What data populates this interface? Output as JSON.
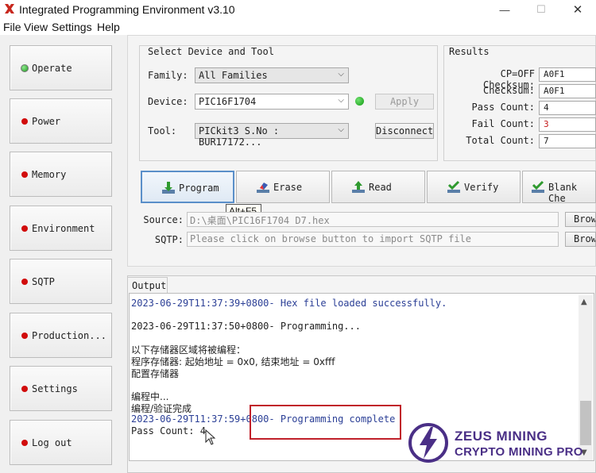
{
  "window": {
    "title": "Integrated Programming Environment v3.10",
    "minimize": "—",
    "maximize": "☐",
    "close": "✕"
  },
  "menu": [
    "File",
    "View",
    "Settings",
    "Help"
  ],
  "sidebar": {
    "items": [
      {
        "label": "Operate",
        "status": "green"
      },
      {
        "label": "Power",
        "status": "red"
      },
      {
        "label": "Memory",
        "status": "red"
      },
      {
        "label": "Environment",
        "status": "red"
      },
      {
        "label": "SQTP",
        "status": "red"
      },
      {
        "label": "Production...",
        "status": "red"
      },
      {
        "label": "Settings",
        "status": "red"
      },
      {
        "label": "Log out",
        "status": "red"
      }
    ]
  },
  "device_group": {
    "title": "Select Device and Tool",
    "family_label": "Family:",
    "family_value": "All Families",
    "device_label": "Device:",
    "device_value": "PIC16F1704",
    "apply_label": "Apply",
    "tool_label": "Tool:",
    "tool_value": "PICkit3 S.No : BUR17172...",
    "disconnect_label": "Disconnect"
  },
  "results": {
    "title": "Results",
    "rows": [
      {
        "label": "CP=OFF Checksum:",
        "value": "A0F1",
        "highlight": false
      },
      {
        "label": "Checksum:",
        "value": "A0F1",
        "highlight": false
      },
      {
        "label": "Pass Count:",
        "value": "4",
        "highlight": false
      },
      {
        "label": "Fail Count:",
        "value": "3",
        "highlight": true
      },
      {
        "label": "Total Count:",
        "value": "7",
        "highlight": false
      }
    ]
  },
  "actions": {
    "program": "Program",
    "erase": "Erase",
    "read": "Read",
    "verify": "Verify",
    "blank_check": "Blank Che",
    "tooltip": "Alt+F5"
  },
  "files": {
    "source_label": "Source:",
    "source_value": "D:\\桌面\\PIC16F1704 D7.hex",
    "sqtp_label": "SQTP:",
    "sqtp_value": "Please click on browse button to import SQTP file",
    "browse_label": "Brow"
  },
  "output": {
    "tab": "Output",
    "lines": [
      "2023-06-29T11:37:39+0800- Hex file loaded successfully.",
      "2023-06-29T11:37:50+0800- Programming...",
      "以下存储器区域将被编程：",
      "程序存储器: 起始地址 = 0x0, 结束地址 = 0xfff",
      "配置存储器",
      "编程中...",
      "编程/验证完成",
      "2023-06-29T11:37:59+0800- Programming complete",
      "Pass Count: 4"
    ]
  },
  "watermark": {
    "line1": "ZEUS MINING",
    "line2": "CRYPTO MINING PRO"
  },
  "colors": {
    "accent_blue": "#2b3f96",
    "highlight_red": "#c0202a",
    "watermark_purple": "#4a2f86",
    "status_green": "#1f9a1f",
    "status_red": "#d10c0c"
  }
}
